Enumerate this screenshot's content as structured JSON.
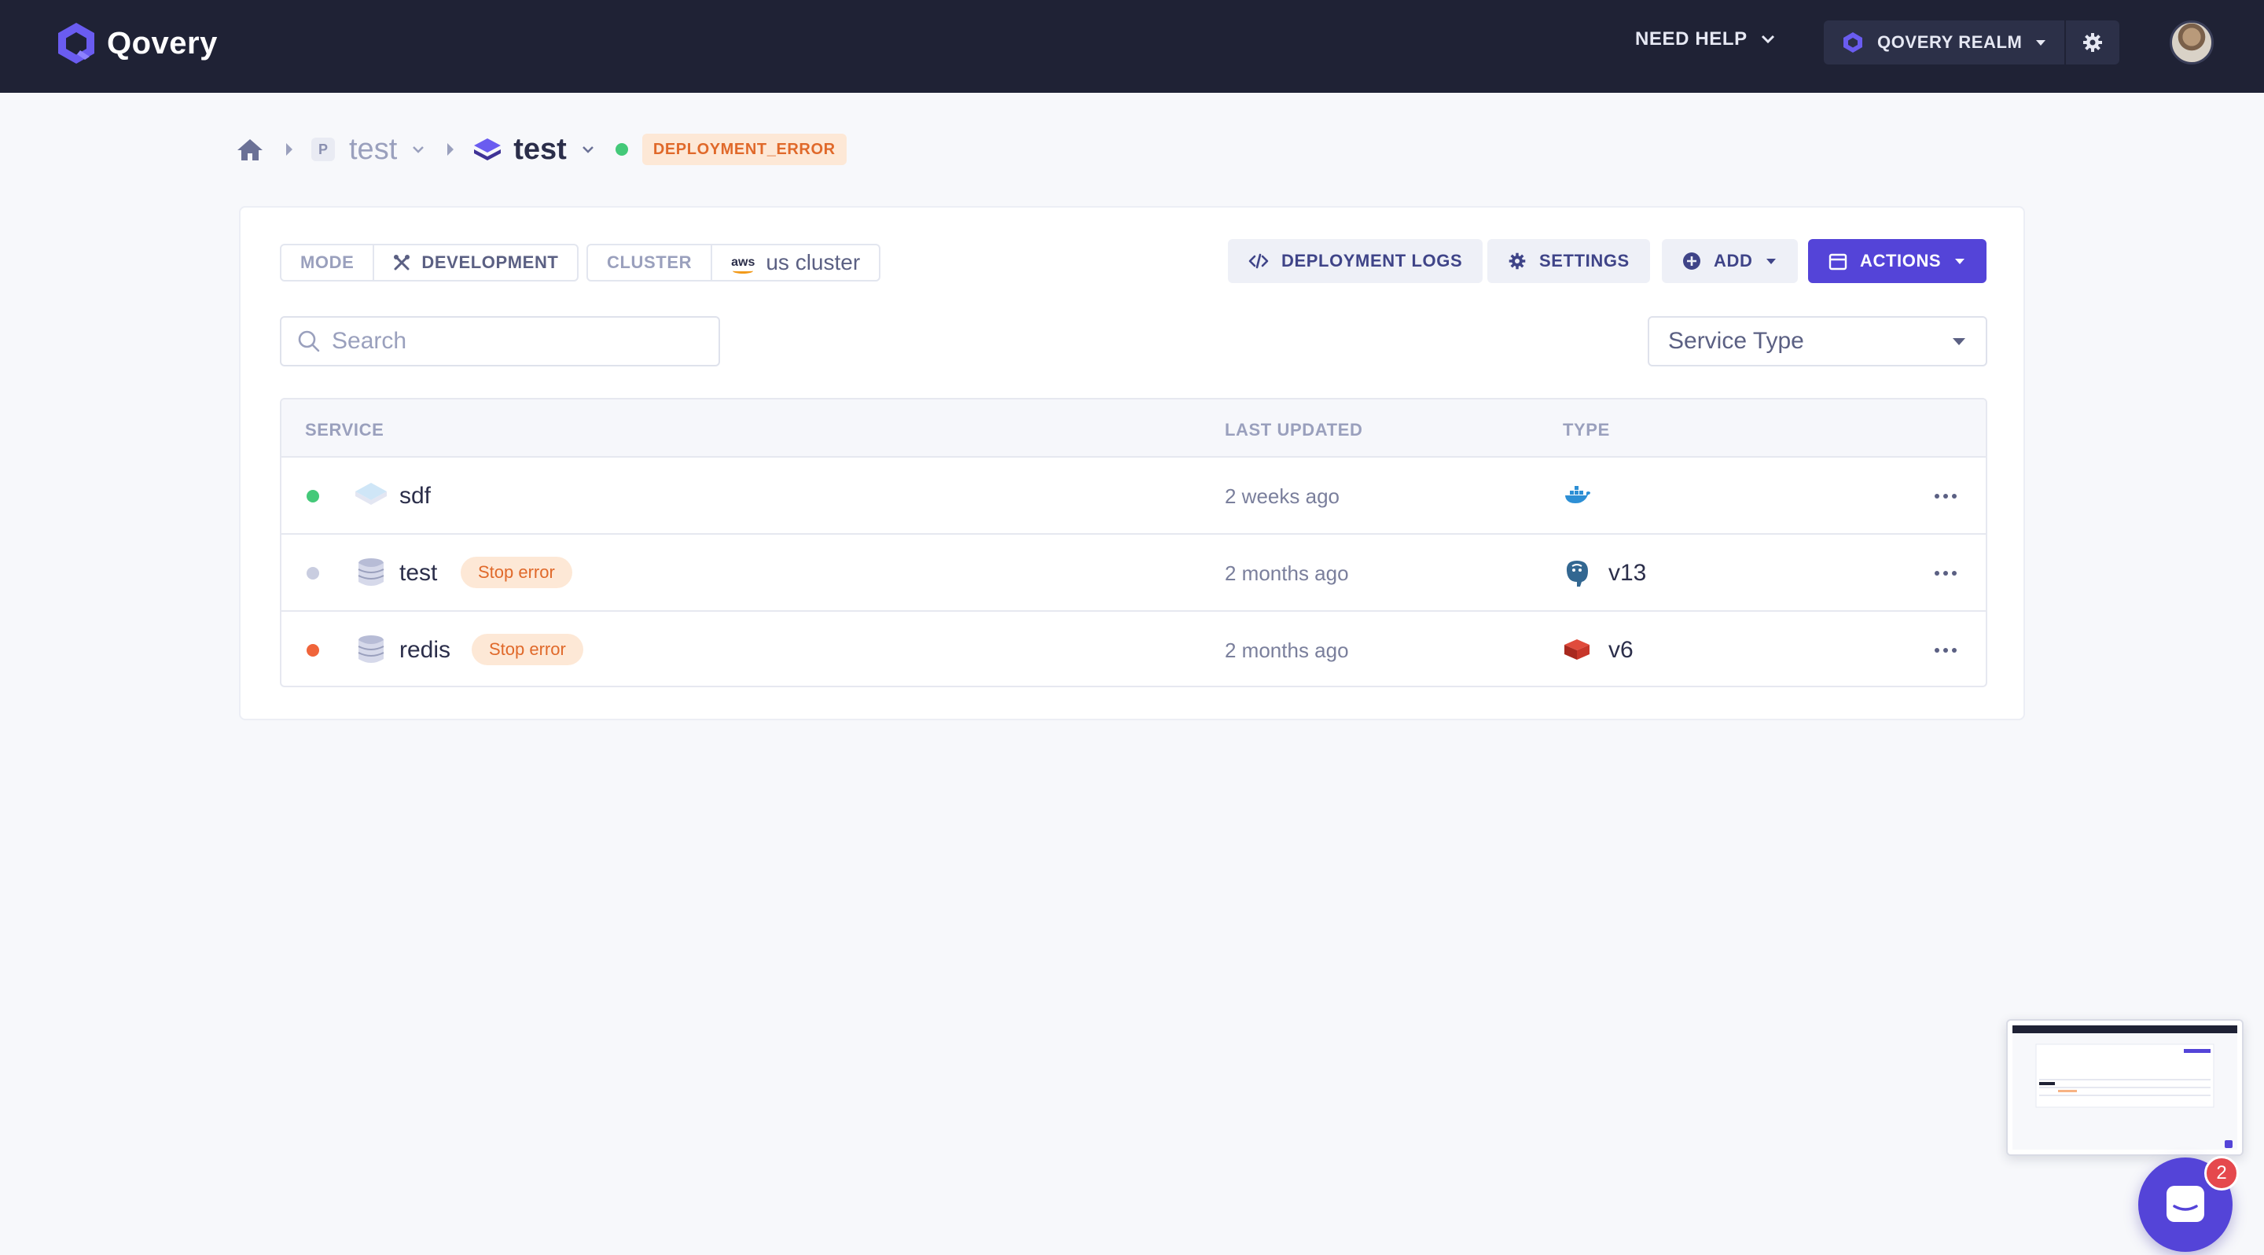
{
  "app": {
    "name": "Qovery"
  },
  "topnav": {
    "need_help": "NEED HELP",
    "org_name": "QOVERY REALM"
  },
  "breadcrumb": {
    "project_badge": "P",
    "project_name": "test",
    "environment_name": "test",
    "environment_status": "DEPLOYMENT_ERROR"
  },
  "toolbar": {
    "mode_label": "MODE",
    "mode_value": "DEVELOPMENT",
    "cluster_label": "CLUSTER",
    "cluster_provider": "aws",
    "cluster_value": "us cluster",
    "deployment_logs": "DEPLOYMENT LOGS",
    "settings": "SETTINGS",
    "add": "ADD",
    "actions": "ACTIONS"
  },
  "filters": {
    "search_placeholder": "Search",
    "service_type": "Service Type"
  },
  "table": {
    "columns": [
      "SERVICE",
      "LAST UPDATED",
      "TYPE"
    ],
    "rows": [
      {
        "name": "sdf",
        "status_color": "#44c979",
        "badge": "",
        "updated": "2 weeks ago",
        "type_icon": "docker-icon",
        "version": ""
      },
      {
        "name": "test",
        "status_color": "#c9cde0",
        "badge": "Stop error",
        "updated": "2 months ago",
        "type_icon": "postgresql-icon",
        "version": "v13"
      },
      {
        "name": "redis",
        "status_color": "#f0643a",
        "badge": "Stop error",
        "updated": "2 months ago",
        "type_icon": "redis-icon",
        "version": "v6"
      }
    ]
  },
  "chat": {
    "unread": "2"
  },
  "colors": {
    "primary": "#5444d8",
    "nav_bg": "#1f2235",
    "error": "#e0692a",
    "success": "#44c979"
  }
}
